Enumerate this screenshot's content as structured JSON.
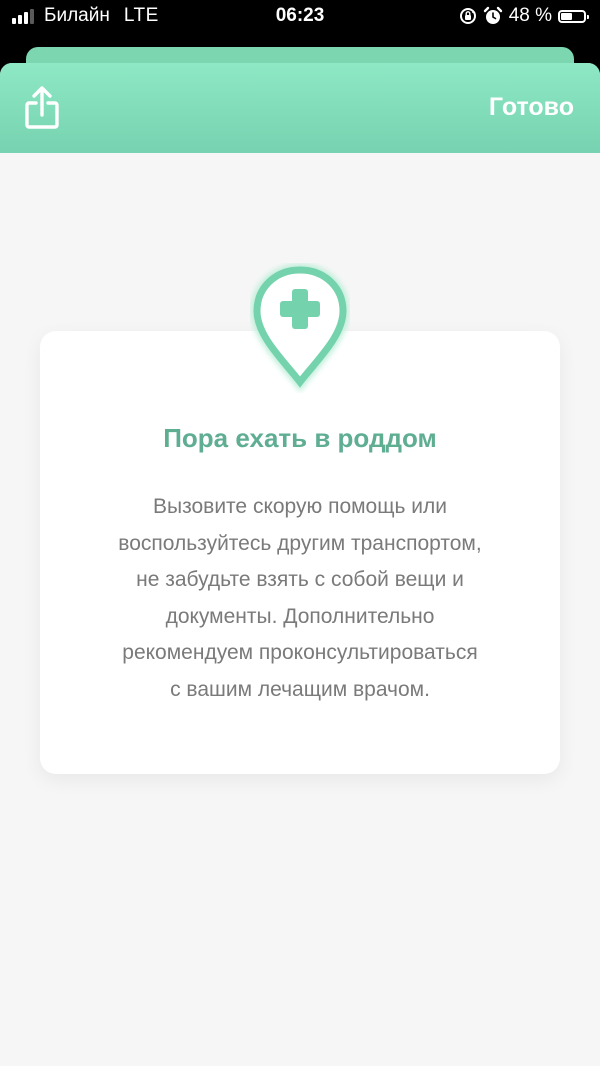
{
  "status_bar": {
    "carrier": "Билайн",
    "network": "LTE",
    "time": "06:23",
    "battery_percent": "48 %",
    "battery_level": 0.48
  },
  "nav": {
    "share_icon": "share-icon",
    "done_label": "Готово"
  },
  "card": {
    "icon": "medical-pin-icon",
    "title": "Пора ехать в роддом",
    "body_lines": [
      "Вызовите скорую помощь или",
      "воспользуйтесь другим транспортом,",
      "не забудьте взять с собой вещи и",
      "документы. Дополнительно",
      "рекомендуем проконсультироваться",
      "с вашим лечащим врачом."
    ]
  },
  "colors": {
    "accent": "#7cd6b0",
    "title": "#5fae92",
    "body_text": "#7a7a7a",
    "background": "#f6f6f6"
  }
}
